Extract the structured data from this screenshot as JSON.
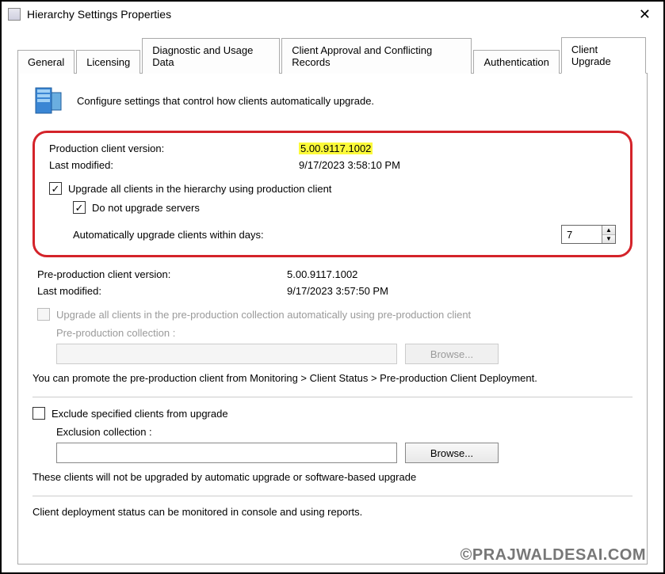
{
  "window": {
    "title": "Hierarchy Settings Properties"
  },
  "tabs": {
    "general": "General",
    "licensing": "Licensing",
    "diag": "Diagnostic and Usage Data",
    "client_approval": "Client Approval and Conflicting Records",
    "auth": "Authentication",
    "client_upgrade": "Client Upgrade"
  },
  "intro": {
    "text": "Configure settings that control how clients automatically upgrade."
  },
  "prod": {
    "version_label": "Production client version:",
    "version_value": "5.00.9117.1002",
    "modified_label": "Last modified:",
    "modified_value": "9/17/2023 3:58:10 PM",
    "upgrade_all_label": "Upgrade all clients in the hierarchy using production client",
    "no_servers_label": "Do not upgrade servers",
    "auto_days_label": "Automatically upgrade clients within days:",
    "auto_days_value": "7"
  },
  "preprod": {
    "version_label": "Pre-production client version:",
    "version_value": "5.00.9117.1002",
    "modified_label": "Last modified:",
    "modified_value": "9/17/2023 3:57:50 PM",
    "upgrade_all_label": "Upgrade all clients in the pre-production collection automatically using pre-production client",
    "collection_label": "Pre-production collection :",
    "browse_label": "Browse...",
    "promote_text": "You can promote the pre-production client from Monitoring > Client Status > Pre-production Client Deployment."
  },
  "exclude": {
    "checkbox_label": "Exclude specified clients from upgrade",
    "collection_label": "Exclusion collection :",
    "browse_label": "Browse...",
    "help_text": "These clients will not be upgraded by automatic upgrade or software-based upgrade"
  },
  "footer": {
    "status_text": "Client deployment status can be monitored in console and using reports."
  },
  "watermark": "©PRAJWALDESAI.COM"
}
